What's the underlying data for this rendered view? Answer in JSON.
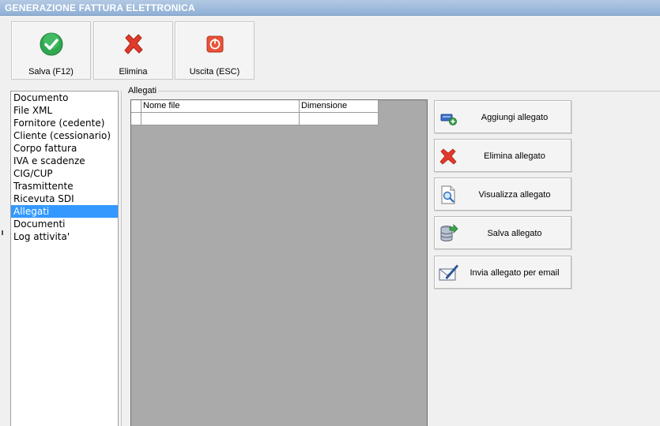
{
  "window": {
    "title": "GENERAZIONE FATTURA ELETTRONICA"
  },
  "toolbar": {
    "save_label": "Salva (F12)",
    "delete_label": "Elimina",
    "exit_label": "Uscita (ESC)"
  },
  "nav": {
    "items": [
      {
        "label": "Documento"
      },
      {
        "label": "File XML"
      },
      {
        "label": "Fornitore (cedente)"
      },
      {
        "label": "Cliente (cessionario)"
      },
      {
        "label": "Corpo fattura"
      },
      {
        "label": "IVA e scadenze"
      },
      {
        "label": "CIG/CUP"
      },
      {
        "label": "Trasmittente"
      },
      {
        "label": "Ricevuta SDI"
      },
      {
        "label": "Allegati"
      },
      {
        "label": "Documenti"
      },
      {
        "label": "Log attivita'"
      }
    ],
    "selected": "Allegati"
  },
  "attachments": {
    "group_label": "Allegati",
    "columns": [
      "Nome file",
      "Dimensione"
    ],
    "rows": [
      [
        "",
        ""
      ]
    ]
  },
  "actions": {
    "add": "Aggiungi allegato",
    "delete": "Elimina allegato",
    "view": "Visualizza allegato",
    "save": "Salva allegato",
    "email": "Invia allegato per email"
  },
  "colors": {
    "title_bar": "#a6bfdf",
    "selection": "#3399ff",
    "grid_background": "#aaaaaa",
    "accent_green": "#2fa84f",
    "accent_red": "#e03a2a"
  }
}
